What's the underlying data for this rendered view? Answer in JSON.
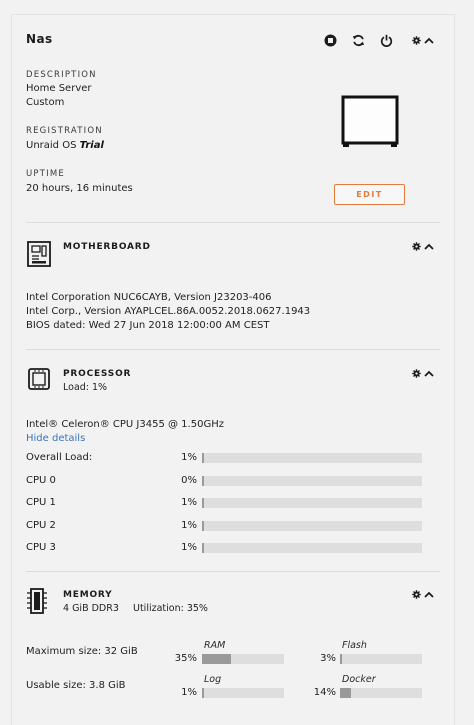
{
  "server": {
    "name": "Nas",
    "description_label": "DESCRIPTION",
    "description_line1": "Home Server",
    "description_line2": "Custom",
    "registration_label": "REGISTRATION",
    "registration_prefix": "Unraid OS",
    "registration_type": "Trial",
    "uptime_label": "UPTIME",
    "uptime_value": "20 hours, 16 minutes",
    "edit_label": "EDIT"
  },
  "motherboard": {
    "title": "MOTHERBOARD",
    "line1": "Intel Corporation NUC6CAYB, Version J23203-406",
    "line2": "Intel Corp., Version AYAPLCEL.86A.0052.2018.0627.1943",
    "line3": "BIOS dated: Wed 27 Jun 2018 12:00:00 AM CEST"
  },
  "processor": {
    "title": "PROCESSOR",
    "load_summary": "Load: 1%",
    "model": "Intel® Celeron® CPU J3455 @ 1.50GHz",
    "hide_details": "Hide details",
    "rows": [
      {
        "label": "Overall Load:",
        "value": "1%",
        "fraction": 0.01
      },
      {
        "label": "CPU 0",
        "value": "0%",
        "fraction": 0.0
      },
      {
        "label": "CPU 1",
        "value": "1%",
        "fraction": 0.01
      },
      {
        "label": "CPU 2",
        "value": "1%",
        "fraction": 0.01
      },
      {
        "label": "CPU 3",
        "value": "1%",
        "fraction": 0.01
      }
    ]
  },
  "memory": {
    "title": "MEMORY",
    "installed": "4 GiB DDR3",
    "utilization": "Utilization: 35%",
    "max_size": "Maximum size: 32 GiB",
    "usable_size": "Usable size: 3.8 GiB",
    "bars": [
      {
        "label": "RAM",
        "value": "35%",
        "fraction": 0.35
      },
      {
        "label": "Flash",
        "value": "3%",
        "fraction": 0.03
      },
      {
        "label": "Log",
        "value": "1%",
        "fraction": 0.01
      },
      {
        "label": "Docker",
        "value": "14%",
        "fraction": 0.14
      }
    ]
  },
  "colors": {
    "accent": "#e27b3b",
    "link": "#3b73b9",
    "bar_track": "#dedede",
    "bar_fill": "#9a9a9a"
  }
}
